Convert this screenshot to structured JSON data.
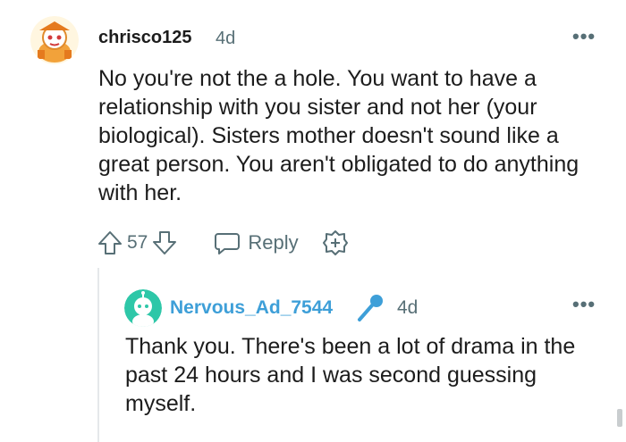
{
  "comment": {
    "username": "chrisco125",
    "age": "4d",
    "more_label": "•••",
    "body": "No you're not the a hole. You want to have a relationship with you sister and not her (your biological). Sisters mother doesn't sound like a great person. You aren't obligated to do anything with her.",
    "score": "57",
    "reply_label": "Reply",
    "icons": [
      "upvote-icon",
      "downvote-icon",
      "reply-bubble-icon",
      "award-plus-icon",
      "more-options-icon"
    ]
  },
  "reply": {
    "username": "Nervous_Ad_7544",
    "age": "4d",
    "more_label": "•••",
    "body": "Thank you. There's been a lot of drama in the past 24 hours and I was second guessing myself.",
    "icons": [
      "microphone-icon",
      "more-options-icon"
    ]
  },
  "colors": {
    "username_reply": "#3e9fd8",
    "meta_gray": "#576f76",
    "text": "#1c1c1c",
    "avatar_reply_bg": "#2ec7a8",
    "avatar_top_bg": "#f2c24a"
  }
}
